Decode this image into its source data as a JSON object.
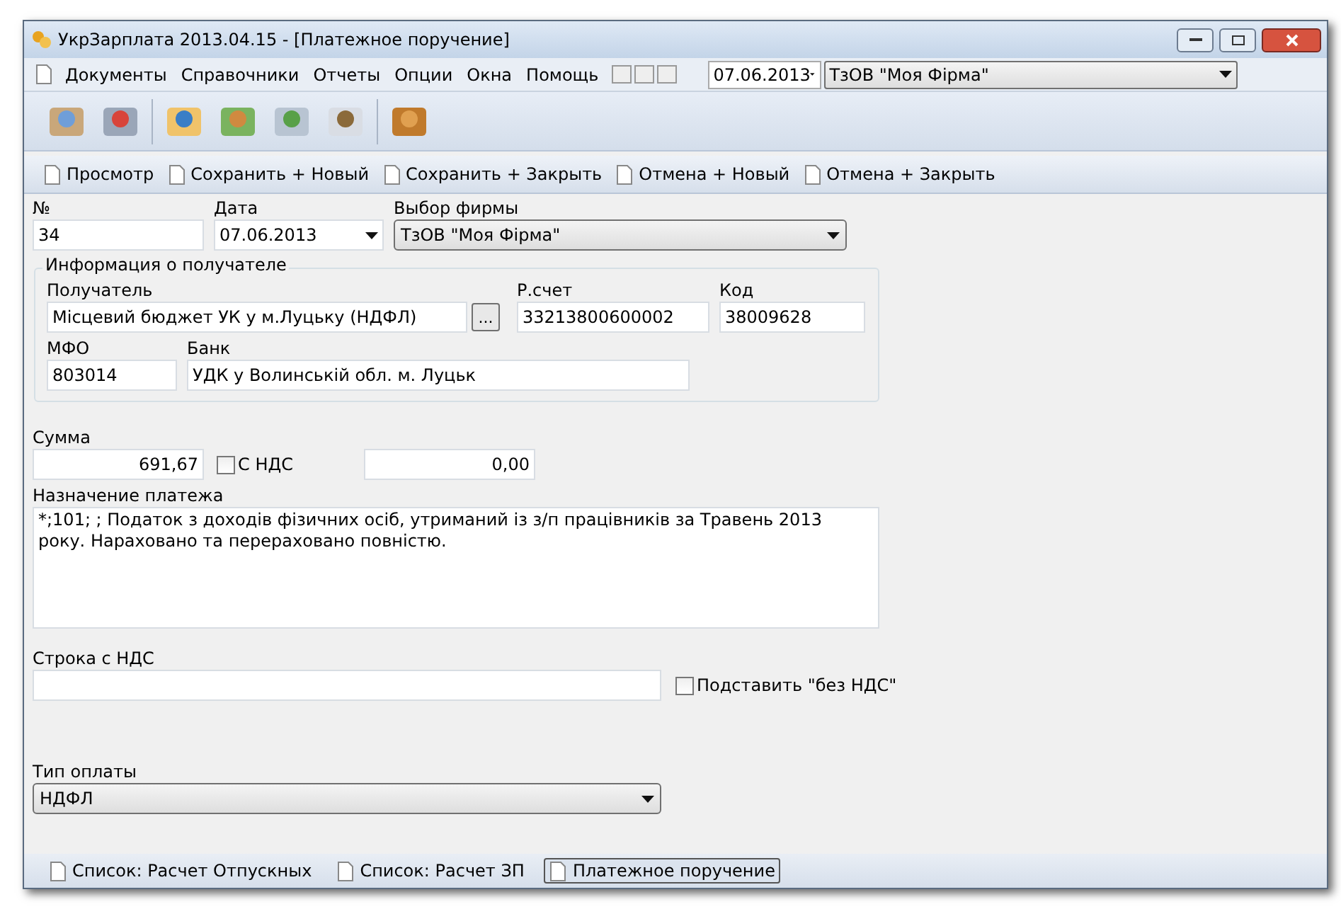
{
  "window": {
    "title": "УкрЗарплата 2013.04.15 - [Платежное поручение]"
  },
  "menu": [
    "Документы",
    "Справочники",
    "Отчеты",
    "Опции",
    "Окна",
    "Помощь"
  ],
  "menu_date": "07.06.2013",
  "menu_firm": "ТзОВ \"Моя Фірма\"",
  "actions": [
    "Просмотр",
    "Сохранить + Новый",
    "Сохранить + Закрыть",
    "Отмена + Новый",
    "Отмена + Закрыть"
  ],
  "form": {
    "number_label": "№",
    "number": "34",
    "date_label": "Дата",
    "date": "07.06.2013",
    "firm_label": "Выбор фирмы",
    "firm": "ТзОВ \"Моя Фірма\"",
    "recipient_group": "Информация о получателе",
    "recipient_label": "Получатель",
    "recipient": "Місцевий бюджет УК у м.Луцьку  (НДФЛ)",
    "browse": "...",
    "account_label": "Р.счет",
    "account": "33213800600002",
    "code_label": "Код",
    "code": "38009628",
    "mfo_label": "МФО",
    "mfo": "803014",
    "bank_label": "Банк",
    "bank": "УДК у Волинській обл. м. Луцьк",
    "sum_label": "Сумма",
    "sum": "691,67",
    "vat_label": "С НДС",
    "vat_checked": false,
    "vat_sum": "0,00",
    "purpose_label": "Назначение платежа",
    "purpose": "*;101; ; Податок з доходів фізичних осіб, утриманий із з/п працівників за Травень 2013 року. Нараховано та перераховано повністю.",
    "vat_line_label": "Строка с НДС",
    "no_vat_label": "Подставить \"без НДС\"",
    "no_vat_checked": false,
    "pay_type_label": "Тип оплаты",
    "pay_type": "НДФЛ"
  },
  "tabs": [
    {
      "label": "Список: Расчет Отпускных",
      "selected": false
    },
    {
      "label": "Список: Расчет ЗП",
      "selected": false
    },
    {
      "label": "Платежное поручение",
      "selected": true
    }
  ]
}
